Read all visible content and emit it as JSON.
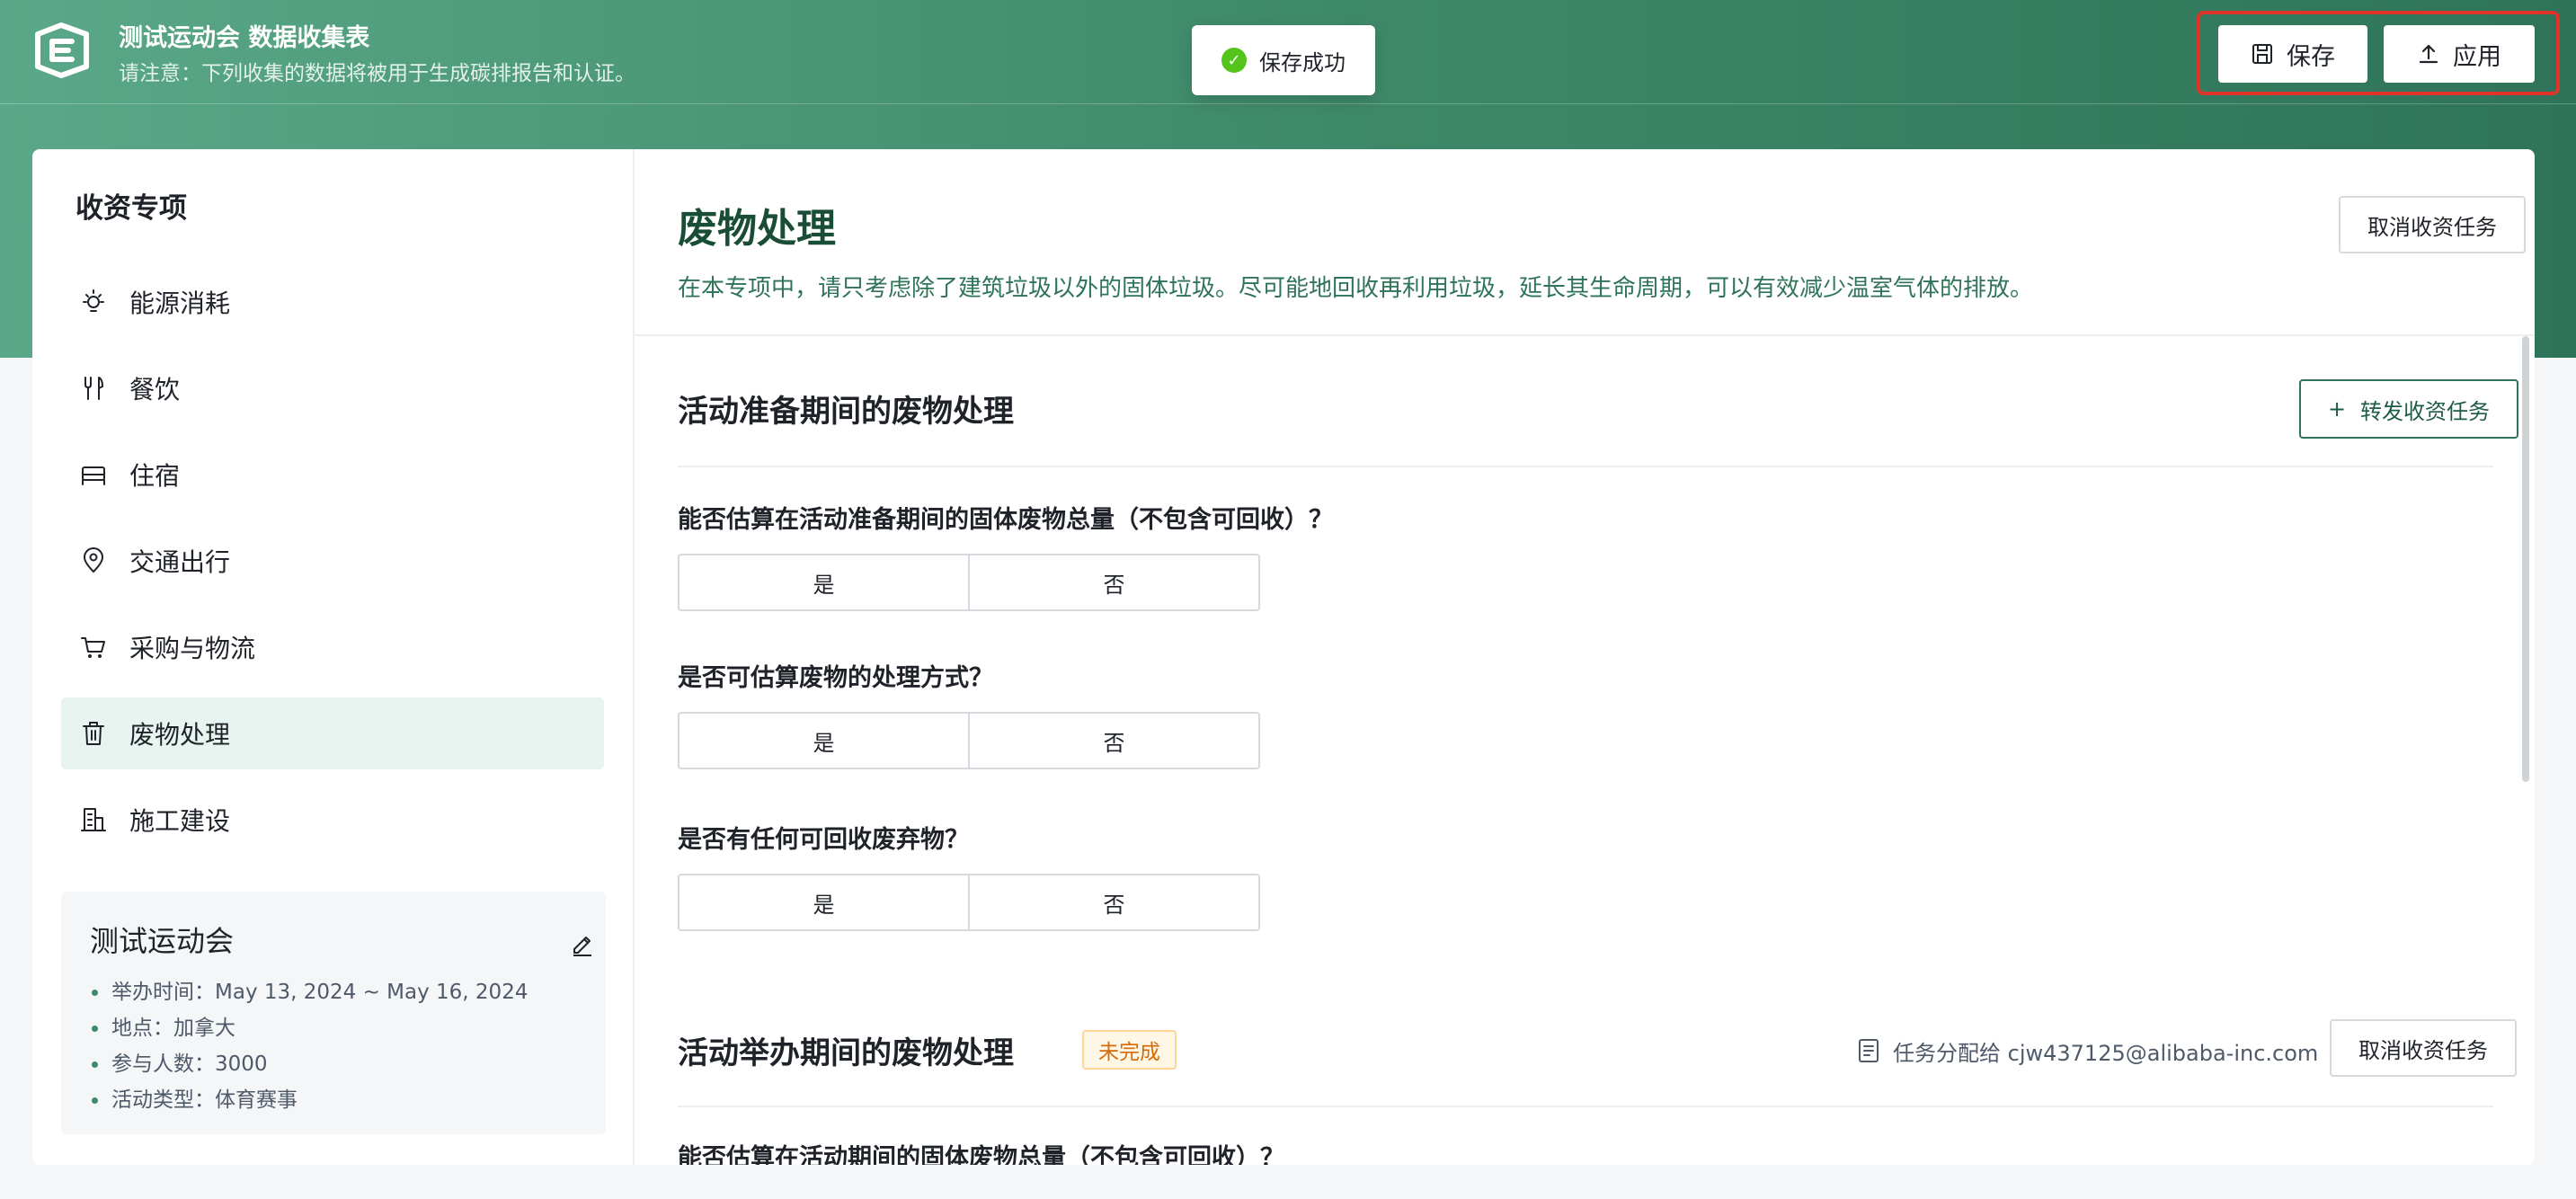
{
  "header": {
    "title": "测试运动会 数据收集表",
    "subtitle": "请注意：下列收集的数据将被用于生成碳排报告和认证。",
    "save_label": "保存",
    "apply_label": "应用"
  },
  "toast": {
    "text": "保存成功"
  },
  "sidebar": {
    "title": "收资专项",
    "items": [
      {
        "label": "能源消耗",
        "icon": "lightbulb-icon"
      },
      {
        "label": "餐饮",
        "icon": "utensils-icon"
      },
      {
        "label": "住宿",
        "icon": "bed-icon"
      },
      {
        "label": "交通出行",
        "icon": "location-pin-icon"
      },
      {
        "label": "采购与物流",
        "icon": "cart-icon"
      },
      {
        "label": "废物处理",
        "icon": "trash-icon",
        "active": true
      },
      {
        "label": "施工建设",
        "icon": "building-icon"
      }
    ]
  },
  "event": {
    "name": "测试运动会",
    "details": [
      "举办时间：May 13, 2024 ~ May 16, 2024",
      "地点：加拿大",
      "参与人数：3000",
      "活动类型：体育赛事"
    ]
  },
  "main": {
    "title": "废物处理",
    "description": "在本专项中，请只考虑除了建筑垃圾以外的固体垃圾。尽可能地回收再利用垃圾，延长其生命周期，可以有效减少温室气体的排放。",
    "cancel_task_label": "取消收资任务",
    "sections": [
      {
        "title": "活动准备期间的废物处理",
        "forward_label": "转发收资任务",
        "questions": [
          {
            "text": "能否估算在活动准备期间的固体废物总量（不包含可回收）？",
            "yes": "是",
            "no": "否"
          },
          {
            "text": "是否可估算废物的处理方式？",
            "yes": "是",
            "no": "否"
          },
          {
            "text": "是否有任何可回收废弃物？",
            "yes": "是",
            "no": "否"
          }
        ]
      },
      {
        "title": "活动举办期间的废物处理",
        "status": "未完成",
        "assignee_text": "任务分配给 cjw437125@alibaba-inc.com",
        "cancel_label": "取消收资任务",
        "questions": [
          {
            "text": "能否估算在活动期间的固体废物总量（不包含可回收）？"
          }
        ]
      }
    ]
  },
  "colors": {
    "brand_green": "#3f8a6a",
    "dark_green": "#1a4d36",
    "highlight_red": "#e0342a",
    "success": "#52c41a",
    "warning": "#d46b08"
  }
}
